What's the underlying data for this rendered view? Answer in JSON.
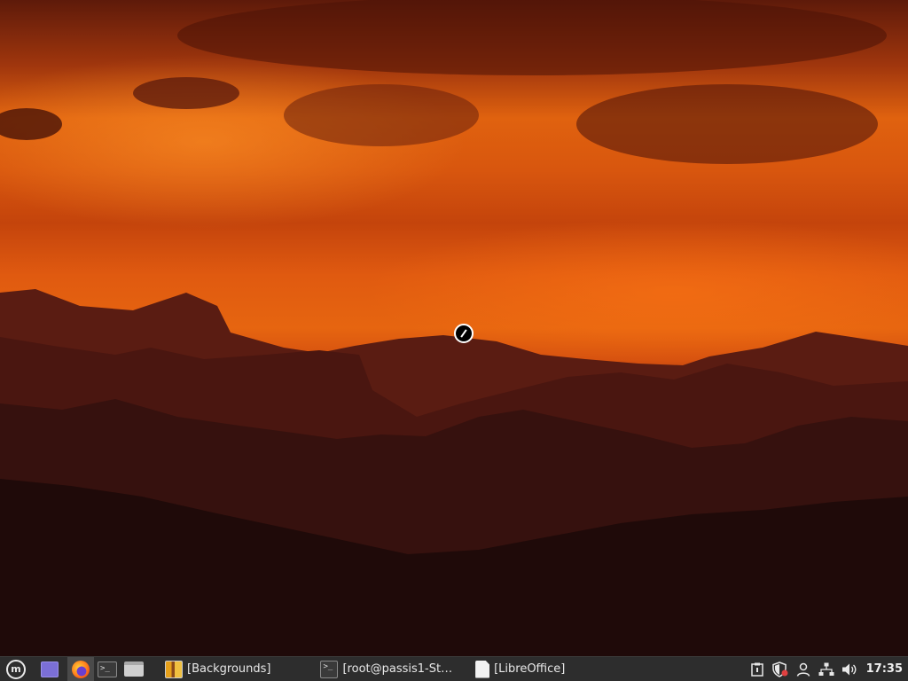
{
  "taskbar": {
    "menu_icon": "linux-mint-logo-icon",
    "launchers": [
      {
        "name": "show-desktop-icon"
      },
      {
        "name": "firefox-icon"
      },
      {
        "name": "terminal-icon"
      },
      {
        "name": "file-manager-icon"
      }
    ],
    "windows": [
      {
        "label": "[Backgrounds]",
        "icon": "backgrounds-icon"
      },
      {
        "label": "[root@passis1-St…",
        "icon": "terminal-icon"
      },
      {
        "label": "[LibreOffice]",
        "icon": "document-icon"
      }
    ],
    "tray": [
      {
        "name": "clipboard-icon"
      },
      {
        "name": "update-shield-icon"
      },
      {
        "name": "user-icon"
      },
      {
        "name": "network-icon"
      },
      {
        "name": "volume-icon"
      }
    ],
    "clock": "17:35"
  },
  "colors": {
    "taskbar_bg": "#2d2d2d",
    "sky_orange": "#e0620f",
    "mountain_dark": "#1a0a09"
  }
}
